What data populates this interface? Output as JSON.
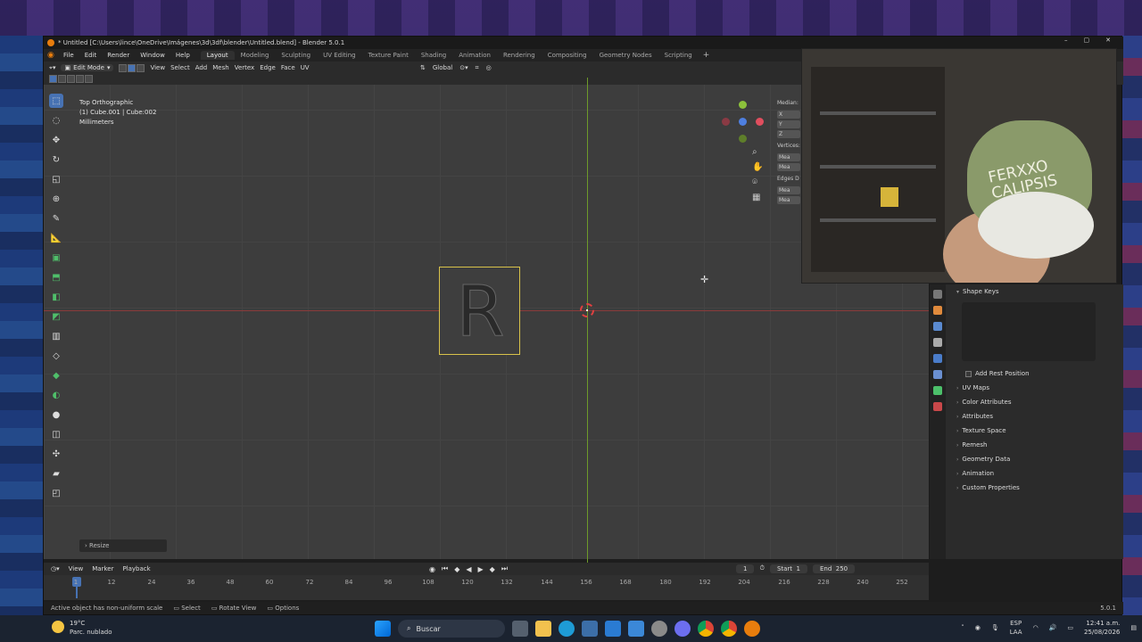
{
  "window": {
    "title": "* Untitled [C:\\Users\\lince\\OneDrive\\Imágenes\\3d\\3df\\blender\\Untitled.blend] - Blender 5.0.1"
  },
  "menubar": {
    "items": [
      "File",
      "Edit",
      "Render",
      "Window",
      "Help"
    ],
    "workspaces": [
      "Layout",
      "Modeling",
      "Sculpting",
      "UV Editing",
      "Texture Paint",
      "Shading",
      "Animation",
      "Rendering",
      "Compositing",
      "Geometry Nodes",
      "Scripting"
    ],
    "active_workspace": "Layout",
    "add_label": "+"
  },
  "header": {
    "mode": "Edit Mode",
    "menus": [
      "View",
      "Select",
      "Add",
      "Mesh",
      "Vertex",
      "Edge",
      "Face",
      "UV"
    ],
    "orientation": "Global"
  },
  "viewport": {
    "view_name": "Top Orthographic",
    "object_info": "(1) Cube.001 | Cube:002",
    "units": "Millimeters",
    "mesh_letter": "R",
    "last_op": "Resize"
  },
  "npanel": {
    "labels": [
      "Median:",
      "X",
      "Y",
      "Z",
      "Vertices:",
      "Mea",
      "Mea",
      "Edges D",
      "Mea",
      "Mea"
    ]
  },
  "properties": {
    "panel_title": "Shape Keys",
    "add_rest": "Add Rest Position",
    "sections": [
      "UV Maps",
      "Color Attributes",
      "Attributes",
      "Texture Space",
      "Remesh",
      "Geometry Data",
      "Animation",
      "Custom Properties"
    ]
  },
  "webcam": {
    "cap_text_line1": "FERXXO",
    "cap_text_line2": "CALIPSIS"
  },
  "timeline": {
    "menus": [
      "View",
      "Marker",
      "Playback"
    ],
    "current_frame": "1",
    "start_label": "Start",
    "start": "1",
    "end_label": "End",
    "end": "250",
    "ticks": [
      "1",
      "12",
      "24",
      "36",
      "48",
      "60",
      "72",
      "84",
      "96",
      "108",
      "120",
      "132",
      "144",
      "156",
      "168",
      "180",
      "192",
      "204",
      "216",
      "228",
      "240",
      "252"
    ]
  },
  "statusbar": {
    "message": "Active object has non-uniform scale",
    "select": "Select",
    "rotate_view": "Rotate View",
    "options": "Options",
    "version": "5.0.1"
  },
  "taskbar": {
    "temperature": "19°C",
    "weather": "Parc. nublado",
    "search": "Buscar",
    "lang_top": "ESP",
    "lang_bottom": "LAA",
    "time": "12:41 a.m.",
    "date": "25/08/2026"
  },
  "colors": {
    "accent": "#4772b3",
    "axis_x": "#8a3a3a",
    "axis_y": "#6e9a2a",
    "blender_orange": "#e87d0d"
  }
}
